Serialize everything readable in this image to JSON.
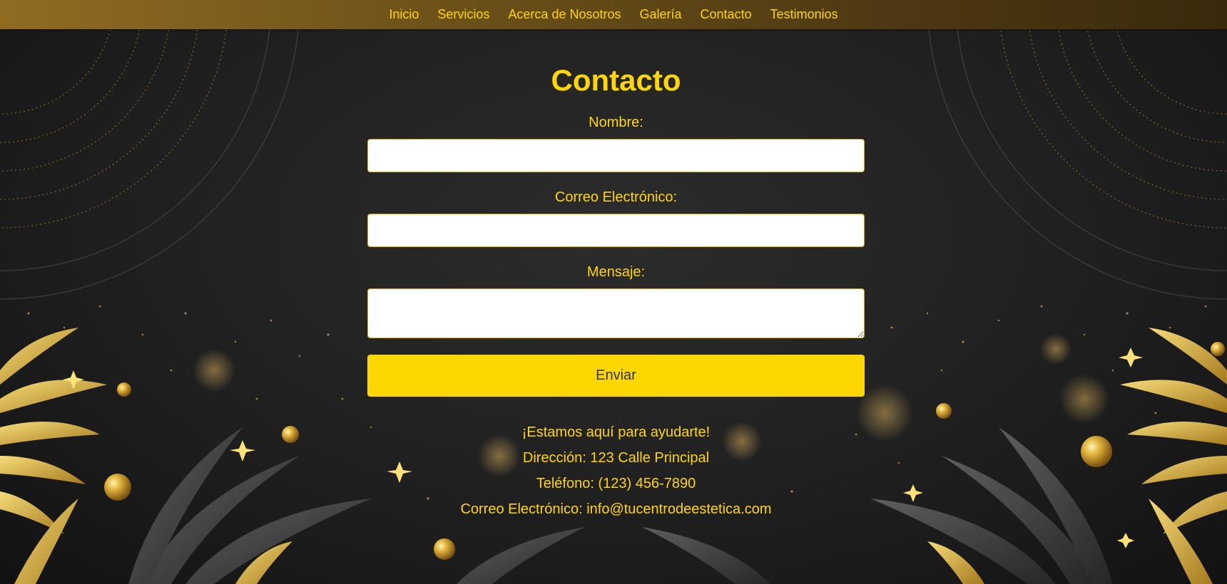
{
  "nav": {
    "items": [
      "Inicio",
      "Servicios",
      "Acerca de Nosotros",
      "Galería",
      "Contacto",
      "Testimonios"
    ]
  },
  "contact": {
    "title": "Contacto",
    "name_label": "Nombre:",
    "name_value": "",
    "email_label": "Correo Electrónico:",
    "email_value": "",
    "message_label": "Mensaje:",
    "message_value": "",
    "submit_label": "Enviar"
  },
  "info": {
    "tagline": "¡Estamos aquí para ayudarte!",
    "address": "Dirección: 123 Calle Principal",
    "phone": "Teléfono: (123) 456-7890",
    "email": "Correo Electrónico: info@tucentrodeestetica.com"
  },
  "colors": {
    "accent": "#ffd700",
    "nav_gradient_start": "#8f6c22",
    "nav_gradient_end": "#3a2a0c",
    "background": "#222222",
    "button_text": "#333333"
  },
  "icons": [
    "palm-leaf-icon",
    "sparkle-star-icon",
    "gold-bead-icon"
  ]
}
